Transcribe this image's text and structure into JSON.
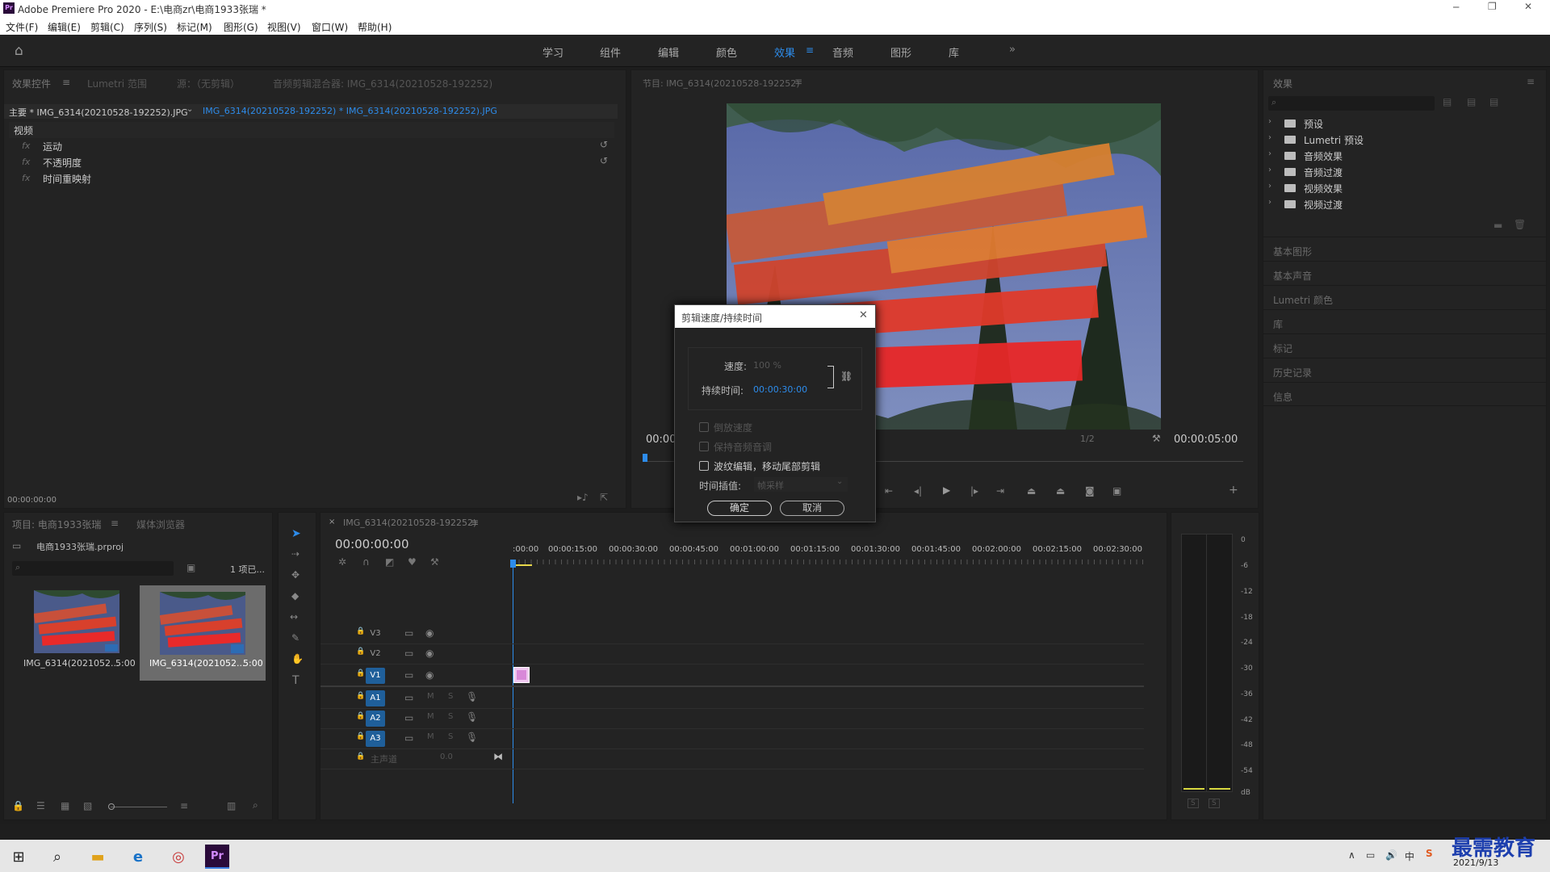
{
  "app": {
    "title": "Adobe Premiere Pro 2020 - E:\\电商zr\\电商1933张瑞 *"
  },
  "menu": [
    "文件(F)",
    "编辑(E)",
    "剪辑(C)",
    "序列(S)",
    "标记(M)",
    "图形(G)",
    "视图(V)",
    "窗口(W)",
    "帮助(H)"
  ],
  "workspaces": [
    "学习",
    "组件",
    "编辑",
    "颜色",
    "效果",
    "音频",
    "图形",
    "库"
  ],
  "effect_controls": {
    "tabs": [
      "效果控件",
      "Lumetri 范围",
      "源：（无剪辑）",
      "音频剪辑混合器: IMG_6314(20210528-192252)"
    ],
    "master_clip": "主要 * IMG_6314(20210528-192252).JPG",
    "seq_clip": "IMG_6314(20210528-192252) * IMG_6314(20210528-192252).JPG",
    "section": "视频",
    "items": [
      "运动",
      "不透明度",
      "时间重映射"
    ],
    "fx": "fx",
    "timecode": "00:00:00:00"
  },
  "program": {
    "tab": "节目: IMG_6314(20210528-192252)",
    "time_left": "00:00",
    "time_right": "00:00:05:00",
    "zoom": "1/2"
  },
  "effects_panel": {
    "tab": "效果",
    "folders": [
      "预设",
      "Lumetri 预设",
      "音频效果",
      "音频过渡",
      "视频效果",
      "视频过渡"
    ],
    "sections": [
      "基本图形",
      "基本声音",
      "Lumetri 颜色",
      "库",
      "标记",
      "历史记录",
      "信息"
    ]
  },
  "dialog": {
    "title": "剪辑速度/持续时间",
    "speed_label": "速度:",
    "speed_value": "100 %",
    "duration_label": "持续时间:",
    "duration_value": "00:00:30:00",
    "reverse": "倒放速度",
    "maintain_pitch": "保持音频音调",
    "ripple": "波纹编辑，移动尾部剪辑",
    "interp_label": "时间插值:",
    "interp_value": "帧采样",
    "ok": "确定",
    "cancel": "取消"
  },
  "project": {
    "tabs": [
      "项目: 电商1933张瑞",
      "媒体浏览器"
    ],
    "file": "电商1933张瑞.prproj",
    "count": "1 项已...",
    "items": [
      {
        "name": "IMG_6314(2021052...",
        "dur": "5:00"
      },
      {
        "name": "IMG_6314(2021052...",
        "dur": "5:00"
      }
    ]
  },
  "timeline": {
    "tab": "IMG_6314(20210528-192252)",
    "timecode": "00:00:00:00",
    "ruler": [
      ":00:00",
      "00:00:15:00",
      "00:00:30:00",
      "00:00:45:00",
      "00:01:00:00",
      "00:01:15:00",
      "00:01:30:00",
      "00:01:45:00",
      "00:02:00:00",
      "00:02:15:00",
      "00:02:30:00"
    ],
    "video_tracks": [
      "V3",
      "V2",
      "V1"
    ],
    "audio_tracks": [
      "A1",
      "A2",
      "A3"
    ],
    "master": "主声道",
    "master_val": "0.0",
    "mute": "M",
    "solo": "S"
  },
  "meter": {
    "scale": [
      "0",
      "-6",
      "-12",
      "-18",
      "-24",
      "-30",
      "-36",
      "-42",
      "-48",
      "-54",
      "dB"
    ],
    "solo": "S"
  },
  "taskbar": {
    "date": "2021/9/13",
    "watermark": "最需教育"
  }
}
